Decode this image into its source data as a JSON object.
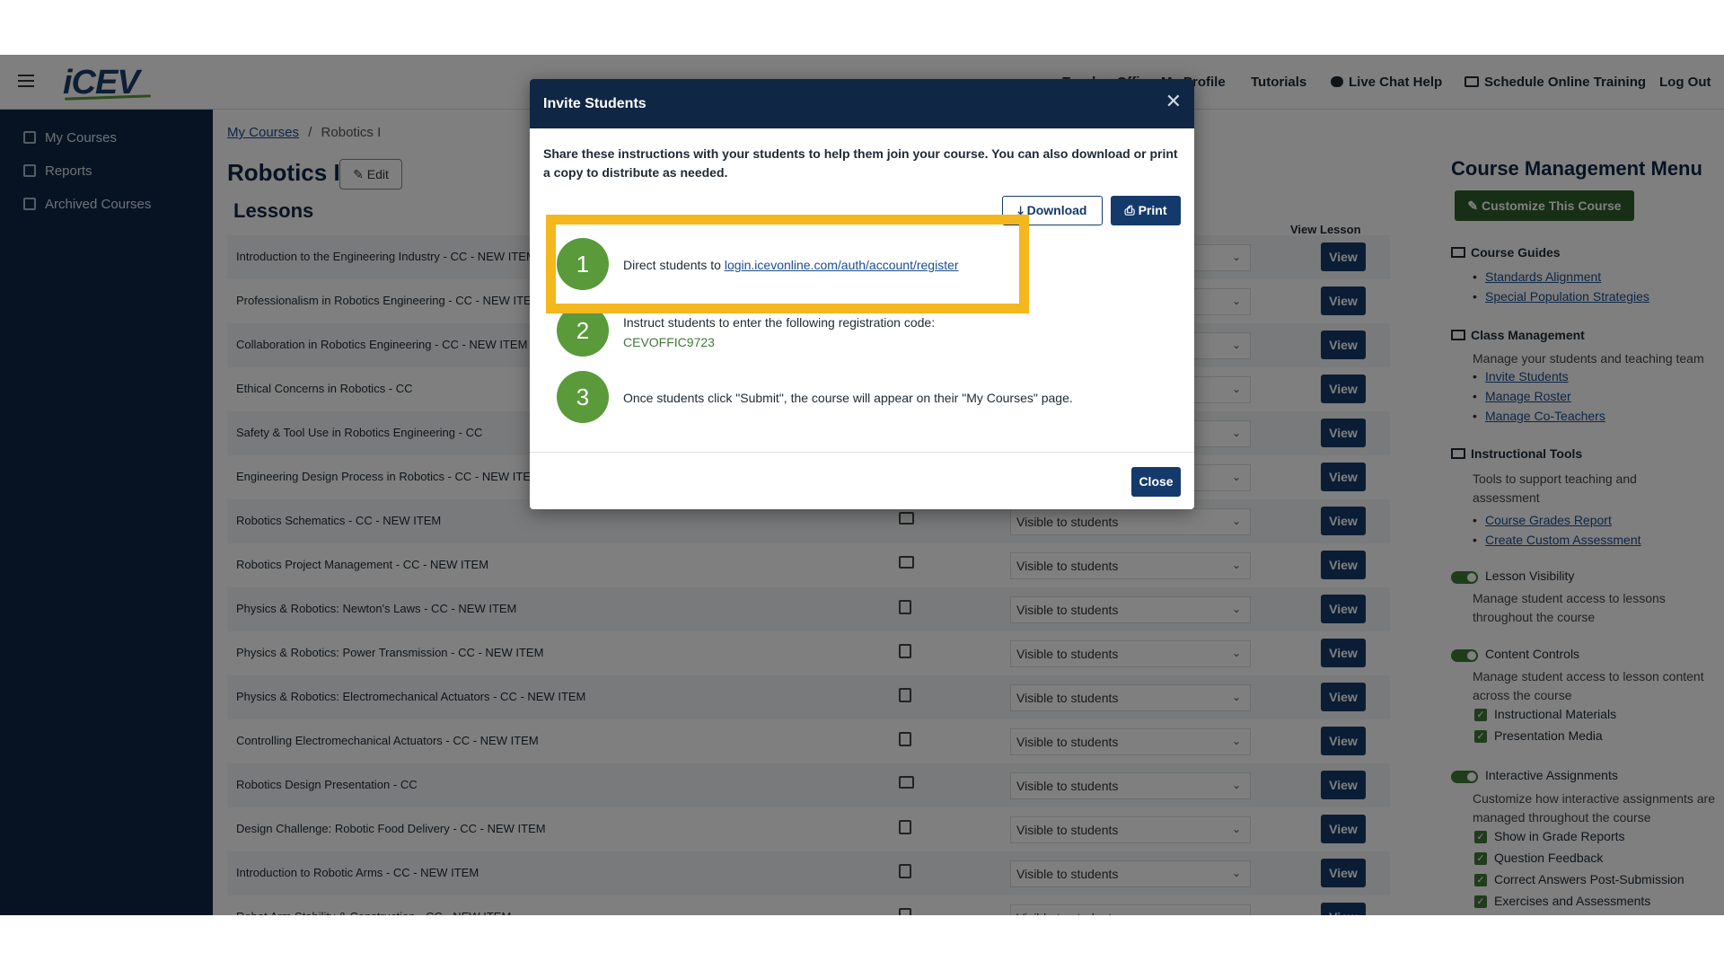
{
  "topnav": {
    "logo": "iCEV",
    "links": [
      "Teacher Office",
      "My Profile",
      "Tutorials",
      "Live Chat Help",
      "Schedule Online Training",
      "Log Out"
    ]
  },
  "sidebar": {
    "items": [
      "My Courses",
      "Reports",
      "Archived Courses"
    ]
  },
  "breadcrumb": {
    "root": "My Courses",
    "sep": "/",
    "current": "Robotics I"
  },
  "page": {
    "title": "Robotics I",
    "edit_label": "Edit",
    "lessons_title": "Lessons",
    "view_lesson_header": "View Lesson"
  },
  "lessons": [
    {
      "title": "Introduction to the Engineering Industry - CC - NEW ITEM",
      "type": "doc"
    },
    {
      "title": "Professionalism in Robotics Engineering - CC - NEW ITEM",
      "type": "doc"
    },
    {
      "title": "Collaboration in Robotics Engineering - CC - NEW ITEM",
      "type": "doc"
    },
    {
      "title": "Ethical Concerns in Robotics - CC",
      "type": "doc"
    },
    {
      "title": "Safety & Tool Use in Robotics Engineering - CC",
      "type": "doc"
    },
    {
      "title": "Engineering Design Process in Robotics - CC - NEW ITEM",
      "type": "doc"
    },
    {
      "title": "Robotics Schematics - CC - NEW ITEM",
      "type": "img"
    },
    {
      "title": "Robotics Project Management - CC - NEW ITEM",
      "type": "img"
    },
    {
      "title": "Physics & Robotics: Newton's Laws - CC - NEW ITEM",
      "type": "doc"
    },
    {
      "title": "Physics & Robotics: Power Transmission - CC - NEW ITEM",
      "type": "doc"
    },
    {
      "title": "Physics & Robotics: Electromechanical Actuators - CC - NEW ITEM",
      "type": "doc"
    },
    {
      "title": "Controlling Electromechanical Actuators - CC - NEW ITEM",
      "type": "doc"
    },
    {
      "title": "Robotics Design Presentation - CC",
      "type": "img"
    },
    {
      "title": "Design Challenge: Robotic Food Delivery - CC - NEW ITEM",
      "type": "doc"
    },
    {
      "title": "Introduction to Robotic Arms - CC - NEW ITEM",
      "type": "doc"
    },
    {
      "title": "Robot Arm Stability & Construction - CC - NEW ITEM",
      "type": "doc"
    }
  ],
  "lesson_visibility_value": "Visible to students",
  "lesson_view_label": "View",
  "cmm": {
    "title": "Course Management Menu",
    "customize": "Customize This Course",
    "course_guides": {
      "title": "Course Guides",
      "links": [
        "Standards Alignment",
        "Special Population Strategies"
      ]
    },
    "class_mgmt": {
      "title": "Class Management",
      "desc": "Manage your students and teaching team",
      "links": [
        "Invite Students",
        "Manage Roster",
        "Manage Co-Teachers"
      ]
    },
    "instr_tools": {
      "title": "Instructional Tools",
      "desc": "Tools to support teaching and assessment",
      "links": [
        "Course Grades Report",
        "Create Custom Assessment"
      ]
    },
    "lesson_vis": {
      "title": "Lesson Visibility",
      "desc": "Manage student access to lessons throughout the course"
    },
    "content_ctrl": {
      "title": "Content Controls",
      "desc": "Manage student access to lesson content across the course",
      "checks": [
        "Instructional Materials",
        "Presentation Media"
      ]
    },
    "interactive": {
      "title": "Interactive Assignments",
      "desc": "Customize how interactive assignments are managed throughout the course",
      "checks": [
        "Show in Grade Reports",
        "Question Feedback",
        "Correct Answers Post-Submission",
        "Exercises and Assessments"
      ]
    }
  },
  "modal": {
    "title": "Invite Students",
    "description": "Share these instructions with your students to help them join your course. You can also download or print a copy to distribute as needed.",
    "download": "Download",
    "print": "Print",
    "steps": [
      {
        "num": "1",
        "text": "Direct students to ",
        "link": "login.icevonline.com/auth/account/register"
      },
      {
        "num": "2",
        "text": "Instruct students to enter the following registration code:",
        "code": "CEVOFFIC9723"
      },
      {
        "num": "3",
        "text": "Once students click \"Submit\", the course will appear on their \"My Courses\" page."
      }
    ],
    "close": "Close"
  },
  "colors": {
    "navy": "#0f2744",
    "green": "#5a9a3a",
    "highlight": "#f5b71e"
  }
}
